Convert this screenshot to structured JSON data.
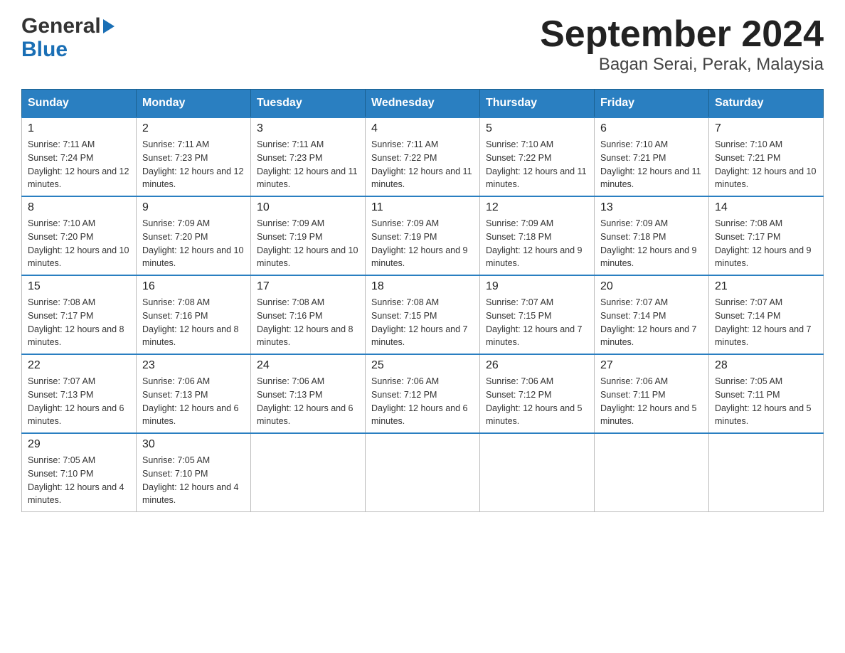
{
  "logo": {
    "line1": "General",
    "line2": "Blue"
  },
  "title": {
    "month_year": "September 2024",
    "location": "Bagan Serai, Perak, Malaysia"
  },
  "headers": [
    "Sunday",
    "Monday",
    "Tuesday",
    "Wednesday",
    "Thursday",
    "Friday",
    "Saturday"
  ],
  "weeks": [
    [
      {
        "day": "1",
        "sunrise": "Sunrise: 7:11 AM",
        "sunset": "Sunset: 7:24 PM",
        "daylight": "Daylight: 12 hours and 12 minutes."
      },
      {
        "day": "2",
        "sunrise": "Sunrise: 7:11 AM",
        "sunset": "Sunset: 7:23 PM",
        "daylight": "Daylight: 12 hours and 12 minutes."
      },
      {
        "day": "3",
        "sunrise": "Sunrise: 7:11 AM",
        "sunset": "Sunset: 7:23 PM",
        "daylight": "Daylight: 12 hours and 11 minutes."
      },
      {
        "day": "4",
        "sunrise": "Sunrise: 7:11 AM",
        "sunset": "Sunset: 7:22 PM",
        "daylight": "Daylight: 12 hours and 11 minutes."
      },
      {
        "day": "5",
        "sunrise": "Sunrise: 7:10 AM",
        "sunset": "Sunset: 7:22 PM",
        "daylight": "Daylight: 12 hours and 11 minutes."
      },
      {
        "day": "6",
        "sunrise": "Sunrise: 7:10 AM",
        "sunset": "Sunset: 7:21 PM",
        "daylight": "Daylight: 12 hours and 11 minutes."
      },
      {
        "day": "7",
        "sunrise": "Sunrise: 7:10 AM",
        "sunset": "Sunset: 7:21 PM",
        "daylight": "Daylight: 12 hours and 10 minutes."
      }
    ],
    [
      {
        "day": "8",
        "sunrise": "Sunrise: 7:10 AM",
        "sunset": "Sunset: 7:20 PM",
        "daylight": "Daylight: 12 hours and 10 minutes."
      },
      {
        "day": "9",
        "sunrise": "Sunrise: 7:09 AM",
        "sunset": "Sunset: 7:20 PM",
        "daylight": "Daylight: 12 hours and 10 minutes."
      },
      {
        "day": "10",
        "sunrise": "Sunrise: 7:09 AM",
        "sunset": "Sunset: 7:19 PM",
        "daylight": "Daylight: 12 hours and 10 minutes."
      },
      {
        "day": "11",
        "sunrise": "Sunrise: 7:09 AM",
        "sunset": "Sunset: 7:19 PM",
        "daylight": "Daylight: 12 hours and 9 minutes."
      },
      {
        "day": "12",
        "sunrise": "Sunrise: 7:09 AM",
        "sunset": "Sunset: 7:18 PM",
        "daylight": "Daylight: 12 hours and 9 minutes."
      },
      {
        "day": "13",
        "sunrise": "Sunrise: 7:09 AM",
        "sunset": "Sunset: 7:18 PM",
        "daylight": "Daylight: 12 hours and 9 minutes."
      },
      {
        "day": "14",
        "sunrise": "Sunrise: 7:08 AM",
        "sunset": "Sunset: 7:17 PM",
        "daylight": "Daylight: 12 hours and 9 minutes."
      }
    ],
    [
      {
        "day": "15",
        "sunrise": "Sunrise: 7:08 AM",
        "sunset": "Sunset: 7:17 PM",
        "daylight": "Daylight: 12 hours and 8 minutes."
      },
      {
        "day": "16",
        "sunrise": "Sunrise: 7:08 AM",
        "sunset": "Sunset: 7:16 PM",
        "daylight": "Daylight: 12 hours and 8 minutes."
      },
      {
        "day": "17",
        "sunrise": "Sunrise: 7:08 AM",
        "sunset": "Sunset: 7:16 PM",
        "daylight": "Daylight: 12 hours and 8 minutes."
      },
      {
        "day": "18",
        "sunrise": "Sunrise: 7:08 AM",
        "sunset": "Sunset: 7:15 PM",
        "daylight": "Daylight: 12 hours and 7 minutes."
      },
      {
        "day": "19",
        "sunrise": "Sunrise: 7:07 AM",
        "sunset": "Sunset: 7:15 PM",
        "daylight": "Daylight: 12 hours and 7 minutes."
      },
      {
        "day": "20",
        "sunrise": "Sunrise: 7:07 AM",
        "sunset": "Sunset: 7:14 PM",
        "daylight": "Daylight: 12 hours and 7 minutes."
      },
      {
        "day": "21",
        "sunrise": "Sunrise: 7:07 AM",
        "sunset": "Sunset: 7:14 PM",
        "daylight": "Daylight: 12 hours and 7 minutes."
      }
    ],
    [
      {
        "day": "22",
        "sunrise": "Sunrise: 7:07 AM",
        "sunset": "Sunset: 7:13 PM",
        "daylight": "Daylight: 12 hours and 6 minutes."
      },
      {
        "day": "23",
        "sunrise": "Sunrise: 7:06 AM",
        "sunset": "Sunset: 7:13 PM",
        "daylight": "Daylight: 12 hours and 6 minutes."
      },
      {
        "day": "24",
        "sunrise": "Sunrise: 7:06 AM",
        "sunset": "Sunset: 7:13 PM",
        "daylight": "Daylight: 12 hours and 6 minutes."
      },
      {
        "day": "25",
        "sunrise": "Sunrise: 7:06 AM",
        "sunset": "Sunset: 7:12 PM",
        "daylight": "Daylight: 12 hours and 6 minutes."
      },
      {
        "day": "26",
        "sunrise": "Sunrise: 7:06 AM",
        "sunset": "Sunset: 7:12 PM",
        "daylight": "Daylight: 12 hours and 5 minutes."
      },
      {
        "day": "27",
        "sunrise": "Sunrise: 7:06 AM",
        "sunset": "Sunset: 7:11 PM",
        "daylight": "Daylight: 12 hours and 5 minutes."
      },
      {
        "day": "28",
        "sunrise": "Sunrise: 7:05 AM",
        "sunset": "Sunset: 7:11 PM",
        "daylight": "Daylight: 12 hours and 5 minutes."
      }
    ],
    [
      {
        "day": "29",
        "sunrise": "Sunrise: 7:05 AM",
        "sunset": "Sunset: 7:10 PM",
        "daylight": "Daylight: 12 hours and 4 minutes."
      },
      {
        "day": "30",
        "sunrise": "Sunrise: 7:05 AM",
        "sunset": "Sunset: 7:10 PM",
        "daylight": "Daylight: 12 hours and 4 minutes."
      },
      null,
      null,
      null,
      null,
      null
    ]
  ]
}
